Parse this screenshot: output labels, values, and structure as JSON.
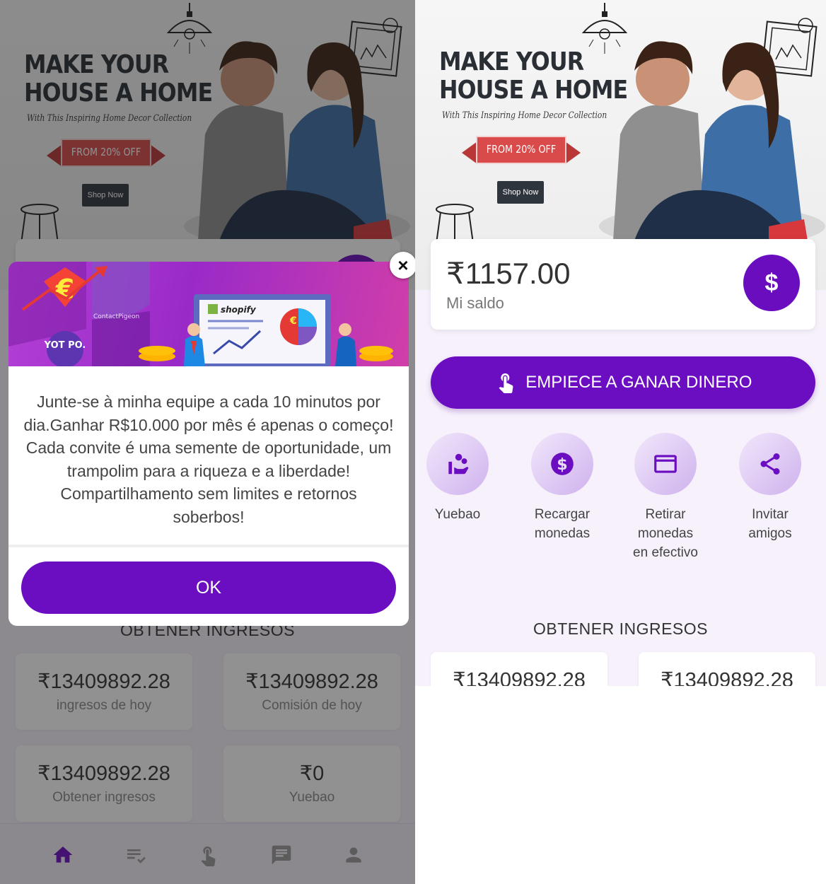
{
  "banner": {
    "headline_line1": "MAKE YOUR",
    "headline_line2": "HOUSE A HOME",
    "subhead": "With This Inspiring Home Decor Collection",
    "offer": "FROM 20% OFF",
    "shop_now": "Shop Now"
  },
  "balance": {
    "amount": "₹1157.00",
    "label": "Mi saldo",
    "dollar_icon": "$"
  },
  "earn_button": {
    "label": "EMPIECE A GANAR DINERO",
    "icon": "tap-icon"
  },
  "actions": [
    {
      "label_line1": "Yuebao",
      "label_line2": "",
      "label_line3": "",
      "icon": "coins-hand-icon"
    },
    {
      "label_line1": "Recargar",
      "label_line2": "monedas",
      "label_line3": "",
      "icon": "dollar-coin-icon"
    },
    {
      "label_line1": "Retirar",
      "label_line2": "monedas",
      "label_line3": "en efectivo",
      "icon": "credit-card-icon"
    },
    {
      "label_line1": "Invitar",
      "label_line2": "amigos",
      "label_line3": "",
      "icon": "share-icon"
    }
  ],
  "income": {
    "title": "OBTENER INGRESOS",
    "stats": [
      {
        "value": "₹13409892.28",
        "caption": "ingresos de hoy"
      },
      {
        "value": "₹13409892.28",
        "caption": "Comisión de hoy"
      },
      {
        "value": "₹13409892.28",
        "caption": "Obtener ingresos"
      },
      {
        "value": "₹0",
        "caption": "Yuebao"
      }
    ]
  },
  "bottom_nav": [
    "home-icon",
    "task-list-icon",
    "tap-icon",
    "chat-icon",
    "person-icon"
  ],
  "modal": {
    "hero_brands": {
      "shopify": "shopify",
      "yotpo": "YOT PO.",
      "contact": "ContactPigeon"
    },
    "message": "Junte-se à minha equipe a cada 10 minutos por dia.Ganhar R$10.000 por mês é apenas o começo!  Cada convite é uma semente de oportunidade, um trampolim para a riqueza e a liberdade! Compartilhamento sem limites e retornos soberbos!",
    "ok": "OK",
    "close": "×"
  },
  "colors": {
    "primary": "#6b0dc0",
    "background": "#f7f1fc",
    "accent_red": "#d94a4a"
  }
}
